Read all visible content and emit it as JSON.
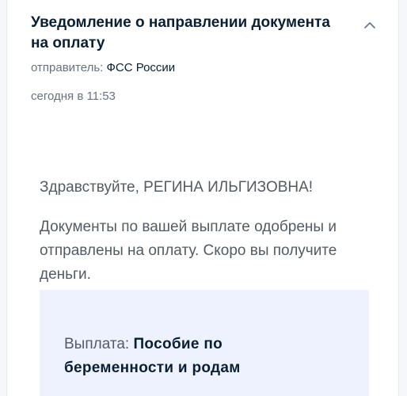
{
  "notification": {
    "title": "Уведомление о направлении документа на оплату",
    "sender_label": "отправитель: ",
    "sender_name": "ФСС России",
    "date": "сегодня в 11:53",
    "toggle_icon": "chevron-up-icon"
  },
  "message": {
    "greeting": "Здравствуйте, РЕГИНА ИЛЬГИЗОВНА!",
    "text": "Документы по вашей выплате одобрены и отправлены на оплату. Скоро вы получите деньги."
  },
  "payment": {
    "label": "Выплата: ",
    "value": "Пособие по беременности и родам"
  },
  "colors": {
    "title": "#0b1f33",
    "secondary_text": "#66727f",
    "body_text": "#535b63",
    "info_box_bg": "#edf2fe"
  }
}
